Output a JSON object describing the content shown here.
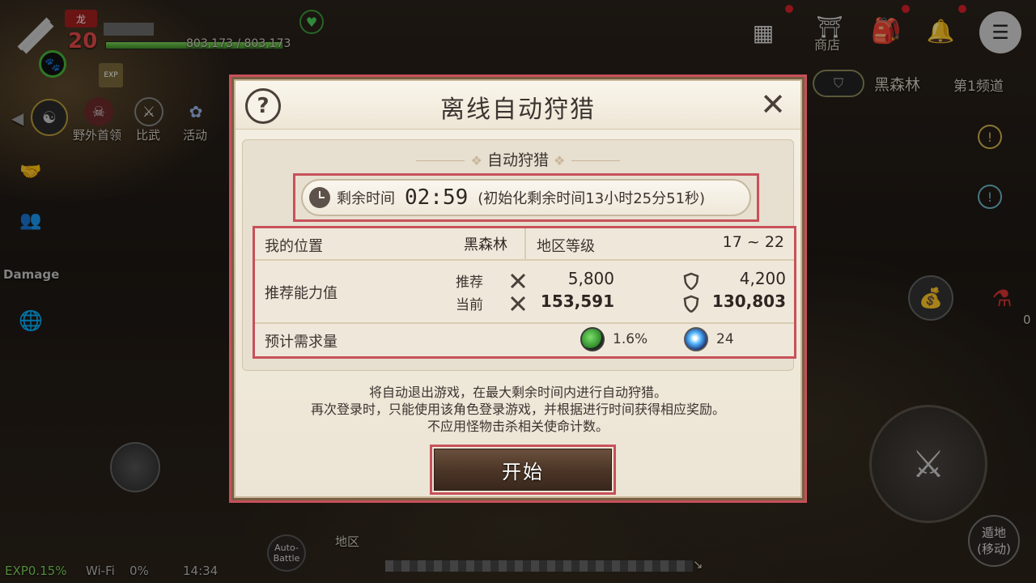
{
  "hud": {
    "level": "20",
    "hp_text": "803,173 / 803,173",
    "hp_fraction": 1.0,
    "exp_badge": "EXP",
    "menu_items": [
      "野外首领",
      "比武",
      "活动"
    ],
    "damage_label": "Damage",
    "shop_label": "商店",
    "location": "黑森林",
    "channel": "第1频道",
    "auto_battle": "Auto-\nBattle",
    "region_label": "地区",
    "exp_percent": "EXP0.15%",
    "wifi": "Wi-Fi",
    "battery": "0%",
    "clock": "14:34",
    "teleport_label": "遁地\n(移动)",
    "potion_count": "0"
  },
  "dialog": {
    "title": "离线自动狩猎",
    "section_title": "自动狩猎",
    "timer_label": "剩余时间",
    "timer_value": "02:59",
    "timer_note": "(初始化剩余时间13小时25分51秒)",
    "rows": {
      "location_label": "我的位置",
      "location_value": "黑森林",
      "region_level_label": "地区等级",
      "region_level_value": "17 ~ 22",
      "power_label": "推荐能力值",
      "recommend_label": "推荐",
      "current_label": "当前",
      "attack_recommend": "5,800",
      "attack_current": "153,591",
      "defense_recommend": "4,200",
      "defense_current": "130,803",
      "requirement_label": "预计需求量",
      "gem_value": "1.6%",
      "orb_value": "24"
    },
    "description": [
      "将自动退出游戏，在最大剩余时间内进行自动狩猎。",
      "再次登录时，只能使用该角色登录游戏，并根据进行时间获得相应奖励。",
      "不应用怪物击杀相关使命计数。"
    ],
    "start_button": "开始"
  },
  "colors": {
    "highlight": "#c7515a",
    "button": "#4c3627",
    "panel": "#ece5d5"
  }
}
